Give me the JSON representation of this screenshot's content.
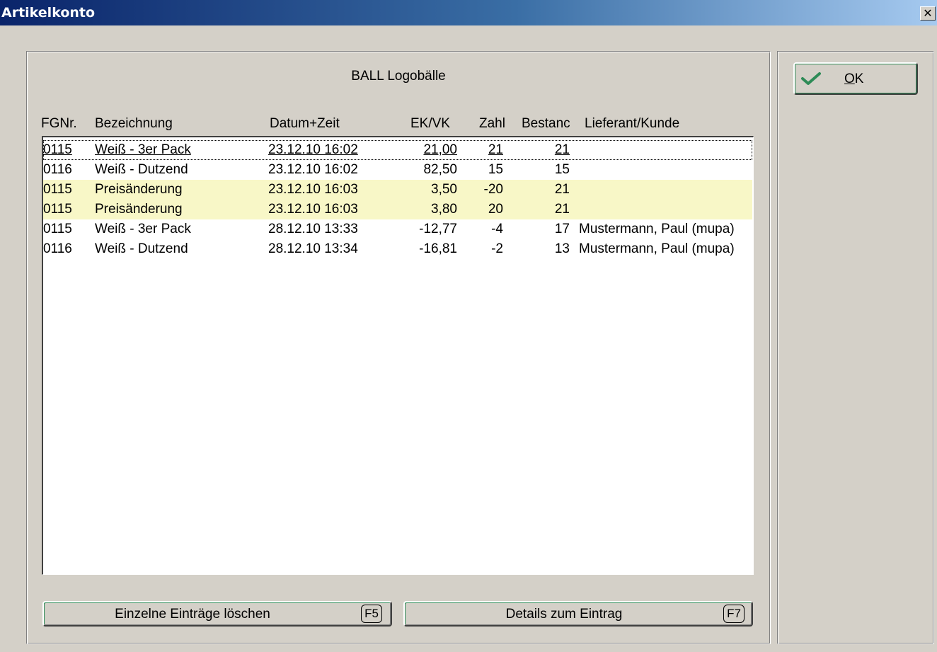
{
  "window": {
    "title": "Artikelkonto",
    "close_glyph": "✕"
  },
  "article": {
    "title": "BALL  Logobälle"
  },
  "columns": [
    "FGNr.",
    "Bezeichnung",
    "Datum+Zeit",
    "EK/VK",
    "Zahl",
    "Bestanc",
    "Lieferant/Kunde"
  ],
  "rows": [
    {
      "fgnr": "0115",
      "bez": "Weiß - 3er Pack",
      "datum": "23.12.10 16:02",
      "ekvk": "21,00",
      "zahl": "21",
      "bestand": "21",
      "lief": "",
      "highlight": false,
      "focused": true
    },
    {
      "fgnr": "0116",
      "bez": "Weiß - Dutzend",
      "datum": "23.12.10 16:02",
      "ekvk": "82,50",
      "zahl": "15",
      "bestand": "15",
      "lief": "",
      "highlight": false,
      "focused": false
    },
    {
      "fgnr": "0115",
      "bez": "Preisänderung",
      "datum": "23.12.10 16:03",
      "ekvk": "3,50",
      "zahl": "-20",
      "bestand": "21",
      "lief": "",
      "highlight": true,
      "focused": false
    },
    {
      "fgnr": "0115",
      "bez": "Preisänderung",
      "datum": "23.12.10 16:03",
      "ekvk": "3,80",
      "zahl": "20",
      "bestand": "21",
      "lief": "",
      "highlight": true,
      "focused": false
    },
    {
      "fgnr": "0115",
      "bez": "Weiß - 3er Pack",
      "datum": "28.12.10 13:33",
      "ekvk": "-12,77",
      "zahl": "-4",
      "bestand": "17",
      "lief": "Mustermann, Paul (mupa)",
      "highlight": false,
      "focused": false
    },
    {
      "fgnr": "0116",
      "bez": "Weiß - Dutzend",
      "datum": "28.12.10 13:34",
      "ekvk": "-16,81",
      "zahl": "-2",
      "bestand": "13",
      "lief": "Mustermann, Paul (mupa)",
      "highlight": false,
      "focused": false
    }
  ],
  "buttons": {
    "delete": {
      "label": "Einzelne Einträge löschen",
      "key": "F5"
    },
    "details": {
      "label": "Details zum Eintrag",
      "key": "F7"
    },
    "ok": {
      "label_accel": "O",
      "label_rest": "K",
      "icon": "checkmark-icon"
    }
  },
  "colors": {
    "highlight_row": "#f8f7c7",
    "title_start": "#0a246a",
    "title_end": "#a6caf0",
    "check": "#2e8b57"
  }
}
